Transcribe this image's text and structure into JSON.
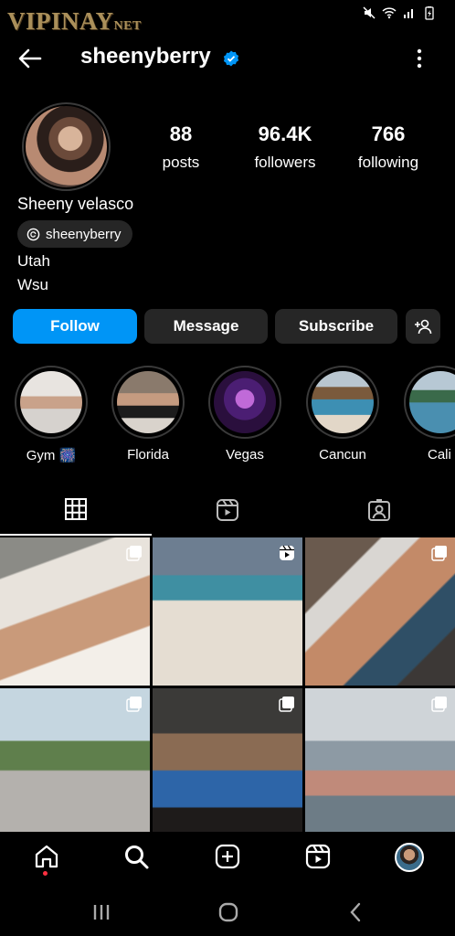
{
  "status_bar": {
    "watermark_main": "VIPINAY",
    "watermark_suffix": "NET",
    "icons": [
      "mute-icon",
      "wifi-icon",
      "signal-icon",
      "battery-icon"
    ]
  },
  "header": {
    "username": "sheenyberry",
    "verified": true,
    "back_icon": "arrow-left-icon",
    "more_icon": "more-vertical-icon"
  },
  "profile": {
    "stats": [
      {
        "value": "88",
        "label": "posts"
      },
      {
        "value": "96.4K",
        "label": "followers"
      },
      {
        "value": "766",
        "label": "following"
      }
    ],
    "full_name": "Sheeny velasco",
    "threads_handle": "sheenyberry",
    "bio_lines": [
      "Utah",
      "Wsu"
    ]
  },
  "actions": {
    "follow": "Follow",
    "message": "Message",
    "subscribe": "Subscribe",
    "add_user_icon": "add-person-icon"
  },
  "highlights": [
    {
      "label": "Gym 🎆"
    },
    {
      "label": "Florida"
    },
    {
      "label": "Vegas"
    },
    {
      "label": "Cancun"
    },
    {
      "label": "Cali"
    }
  ],
  "tabs": [
    "grid-icon",
    "reels-icon",
    "tagged-icon"
  ],
  "posts": [
    {
      "type": "carousel"
    },
    {
      "type": "reel"
    },
    {
      "type": "carousel"
    },
    {
      "type": "carousel"
    },
    {
      "type": "carousel"
    },
    {
      "type": "carousel"
    }
  ],
  "bottom_nav": [
    "home-icon",
    "search-icon",
    "create-icon",
    "reels-icon",
    "profile-avatar"
  ],
  "system_nav": [
    "recents-icon",
    "home-circle-icon",
    "back-chevron-icon"
  ],
  "colors": {
    "accent": "#0095f6",
    "button_bg": "#262626",
    "background": "#000000",
    "notification_dot": "#ff3040"
  }
}
